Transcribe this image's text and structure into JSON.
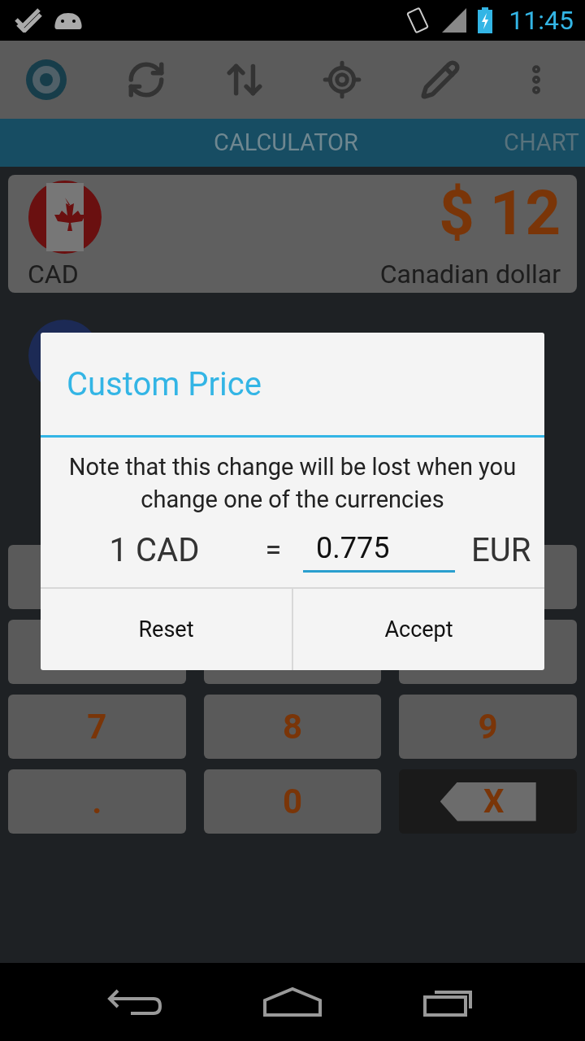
{
  "status_bar": {
    "time": "11:45"
  },
  "tabs": [
    {
      "label": "CALCULATOR",
      "selected": true
    },
    {
      "label": "CHART",
      "selected": false
    }
  ],
  "currency_card": {
    "code": "CAD",
    "amount": "$ 12",
    "name": "Canadian dollar"
  },
  "keypad": [
    {
      "kind": "covered"
    },
    {
      "kind": "gap"
    },
    {
      "kind": "covered"
    },
    {
      "kind": "covered"
    },
    {
      "kind": "covered"
    },
    {
      "kind": "covered"
    },
    {
      "kind": "digit",
      "label": "7"
    },
    {
      "kind": "digit",
      "label": "8"
    },
    {
      "kind": "digit",
      "label": "9"
    },
    {
      "kind": "digit",
      "label": "."
    },
    {
      "kind": "digit",
      "label": "0"
    },
    {
      "kind": "backspace",
      "label": "X"
    }
  ],
  "dialog": {
    "title": "Custom Price",
    "message": "Note that this change will be lost when you change one of the currencies",
    "from": "1 CAD",
    "equals": "=",
    "value": "0.775",
    "to": "EUR",
    "buttons": [
      "Reset",
      "Accept"
    ]
  }
}
